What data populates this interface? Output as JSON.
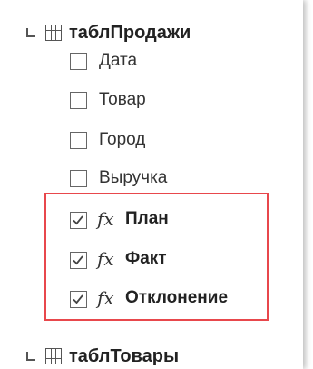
{
  "tables": [
    {
      "name": "таблПродажи",
      "expanded": true,
      "fields": [
        {
          "label": "Дата",
          "checked": false,
          "calculated": false
        },
        {
          "label": "Товар",
          "checked": false,
          "calculated": false
        },
        {
          "label": "Город",
          "checked": false,
          "calculated": false
        },
        {
          "label": "Выручка",
          "checked": false,
          "calculated": false
        },
        {
          "label": "План",
          "checked": true,
          "calculated": true
        },
        {
          "label": "Факт",
          "checked": true,
          "calculated": true
        },
        {
          "label": "Отклонение",
          "checked": true,
          "calculated": true
        }
      ]
    },
    {
      "name": "таблТовары",
      "expanded": true,
      "fields": []
    }
  ],
  "fx_symbol": "fx",
  "colors": {
    "highlight_border": "#e8474c",
    "checkmark": "#444444"
  }
}
